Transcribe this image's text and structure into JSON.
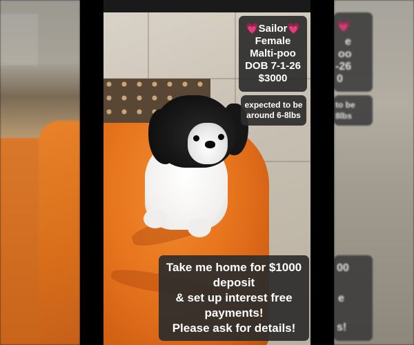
{
  "listing": {
    "name_line": "💗Sailor💗",
    "sex": "Female",
    "breed": "Malti-poo",
    "dob": "DOB 7-1-26",
    "price": "$3000",
    "weight_line1": "expected to be",
    "weight_line2": "around 6-8lbs",
    "deposit_line1": "Take me home for $1000",
    "deposit_line2": "deposit",
    "deposit_line3": "& set up interest free",
    "deposit_line4": "payments!",
    "deposit_line5": "Please ask for details!"
  },
  "ghost": {
    "right_top_1": "💗",
    "right_top_2": "e",
    "right_top_3": "oo",
    "right_top_4": "-26",
    "right_top_5": "0",
    "right_weight_1": "to be",
    "right_weight_2": "8lbs",
    "right_bottom_1": "00",
    "right_bottom_2": "e",
    "right_bottom_3": "s!"
  },
  "colors": {
    "card_bg": "#2d2d2d",
    "blanket": "#e6741d",
    "text": "#ffffff"
  }
}
